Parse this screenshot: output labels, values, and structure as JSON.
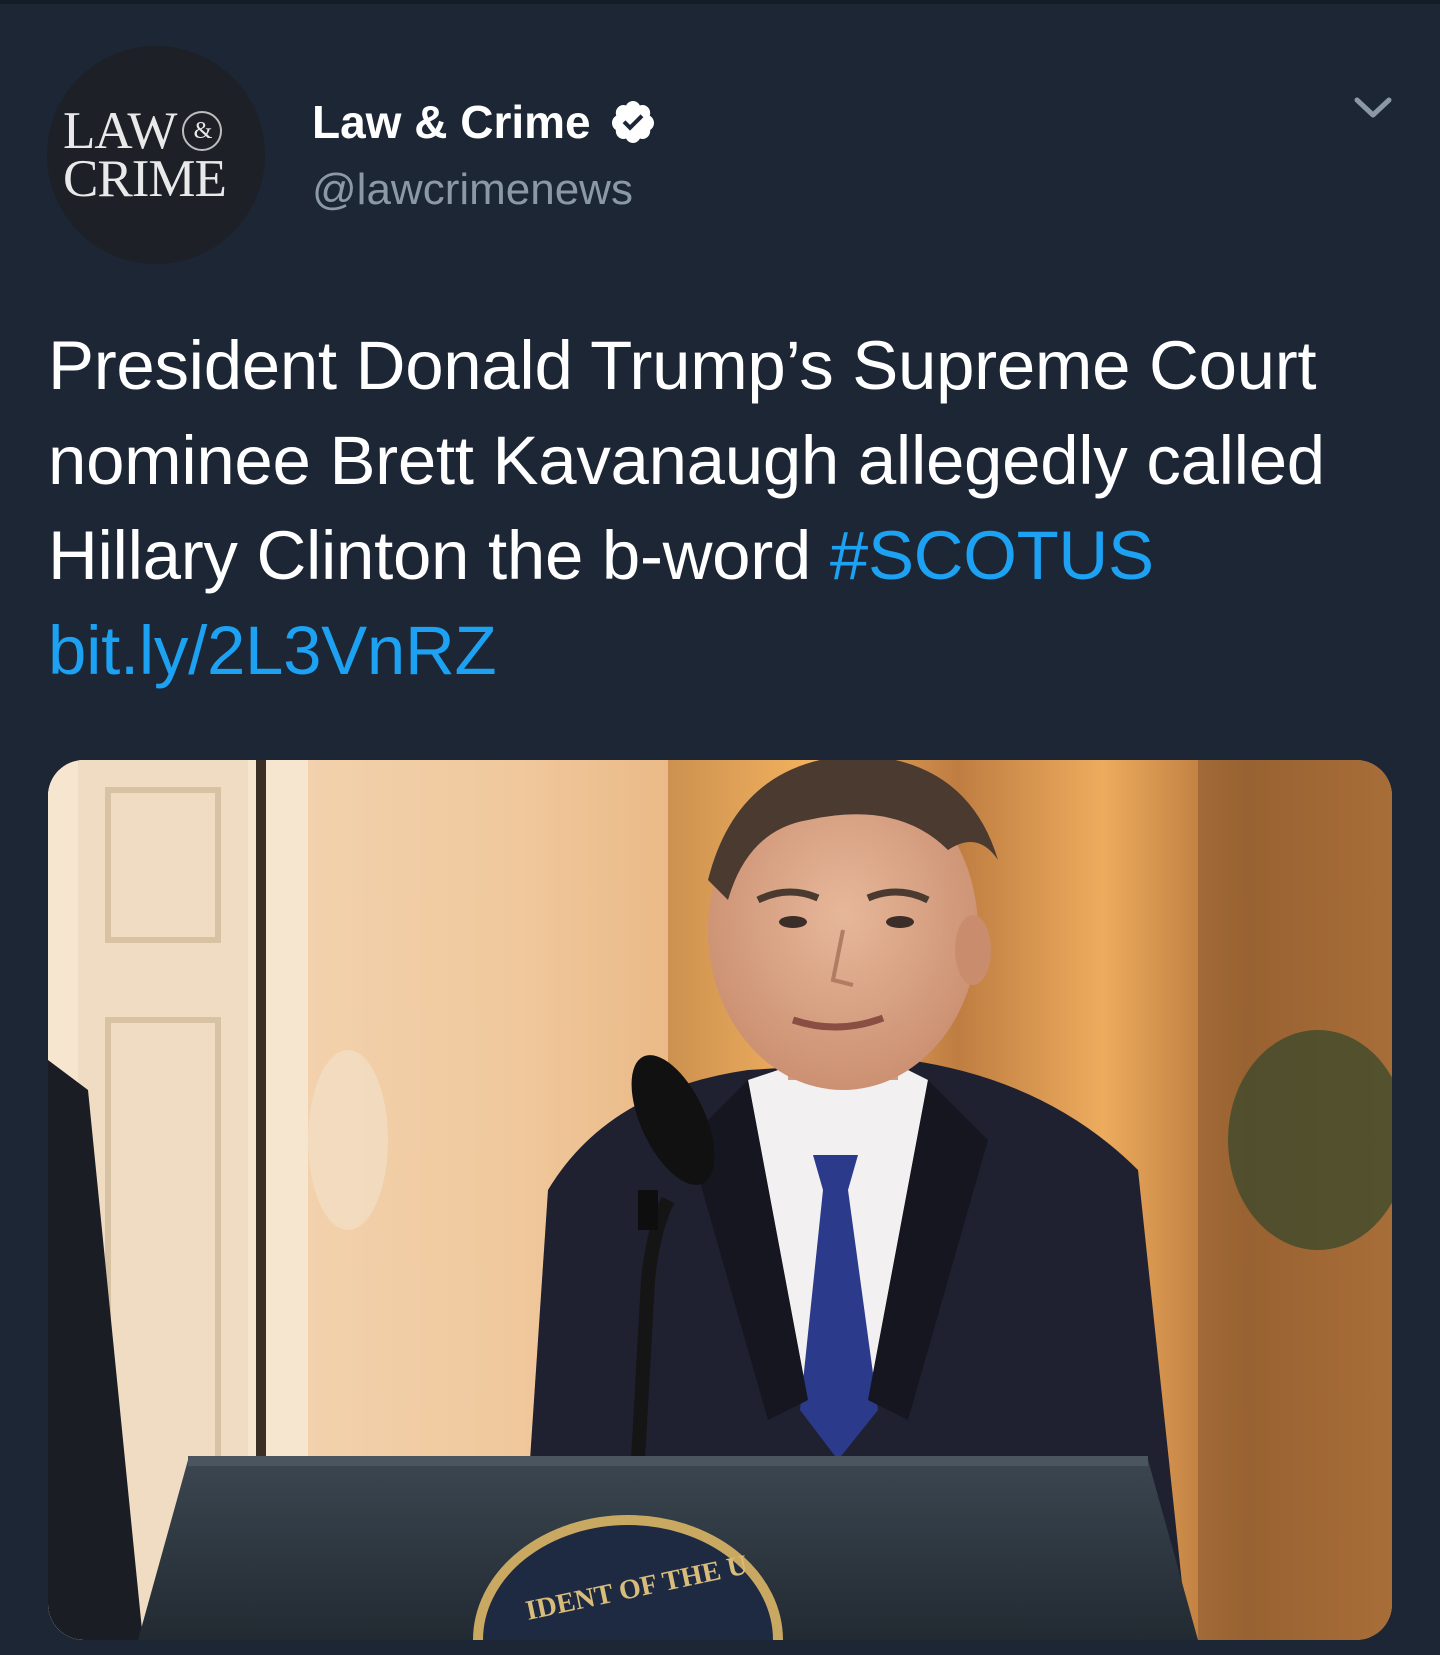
{
  "tweet": {
    "author": {
      "avatar": {
        "line1": "LAW",
        "ampersand": "&",
        "line2": "CRIME"
      },
      "display_name": "Law & Crime",
      "verified_icon": "verified-badge-icon",
      "handle": "@lawcrimenews"
    },
    "menu_icon": "chevron-down-icon",
    "text": {
      "body": "President Donald Trump’s Supreme Court nominee Brett Kavanaugh allegedly called Hillary Clinton the b-word",
      "hashtag": "#SCOTUS",
      "link": "bit.ly/2L3VnRZ"
    },
    "media": {
      "seal_text": "IDENT OF THE U"
    }
  },
  "colors": {
    "background": "#1c2634",
    "text_primary": "#ffffff",
    "text_secondary": "#8b98a5",
    "link": "#1da1f2"
  }
}
